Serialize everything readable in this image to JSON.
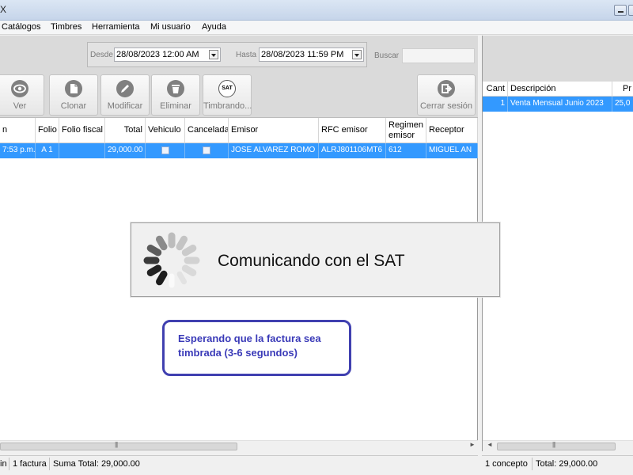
{
  "window": {
    "title": "X"
  },
  "menu": [
    "Catálogos",
    "Timbres",
    "Herramienta",
    "Mi usuario",
    "Ayuda"
  ],
  "filters": {
    "from_label": "Desde",
    "from_value": "28/08/2023  12:00  AM",
    "to_label": "Hasta",
    "to_value": "28/08/2023   11:59  PM",
    "search_label": "Buscar",
    "search_value": ""
  },
  "toolbar": {
    "view": "Ver",
    "clone": "Clonar",
    "modify": "Modificar",
    "delete": "Eliminar",
    "stamp": "Timbrando...",
    "stamp_badge": "SAT",
    "logout": "Cerrar sesión"
  },
  "invoices": {
    "columns": [
      "n",
      "Folio",
      "Folio fiscal",
      "Total",
      "Vehiculo",
      "Cancelada",
      "Emisor",
      "RFC emisor",
      "Regimen emisor",
      "Receptor"
    ],
    "rows": [
      {
        "time": "7:53 p.m.",
        "folio": "A 1",
        "folio_fiscal": "",
        "total": "29,000.00",
        "vehiculo": false,
        "cancelada": false,
        "emisor": "JOSE ALVAREZ ROMO",
        "rfc_emisor": "ALRJ801106MT6",
        "regimen": "612",
        "receptor": "MIGUEL AN"
      }
    ]
  },
  "status_left": {
    "seg1": "in",
    "seg2": "1 factura",
    "seg3": "Suma Total: 29,000.00"
  },
  "concepts": {
    "columns": [
      "Cant",
      "Descripción",
      "Pr"
    ],
    "rows": [
      {
        "cant": "1",
        "descripcion": "Venta Mensual Junio 2023",
        "precio": "25,0"
      }
    ]
  },
  "status_right": {
    "seg1": "1 concepto",
    "seg2": "Total: 29,000.00"
  },
  "dialog": {
    "message": "Comunicando con el SAT"
  },
  "callout": {
    "line1": "Esperando que la factura sea",
    "line2": "timbrada (3-6 segundos)"
  },
  "colors": {
    "selection": "#3399ff",
    "callout_border": "#4040b0",
    "callout_text": "#3a3ab8"
  },
  "icons": [
    "eye-icon",
    "document-icon",
    "pencil-icon",
    "trash-icon",
    "sat-icon",
    "logout-icon",
    "spinner-icon"
  ]
}
